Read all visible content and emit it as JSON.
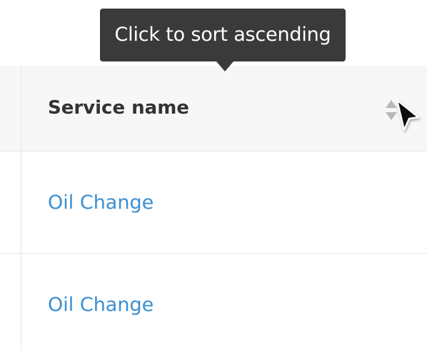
{
  "tooltip": {
    "text": "Click to sort ascending"
  },
  "table": {
    "columns": [
      {
        "label": "Service name",
        "sortable": true
      }
    ],
    "rows": [
      {
        "service_name": "Oil Change"
      },
      {
        "service_name": "Oil Change"
      }
    ]
  },
  "colors": {
    "link": "#3b8fd0",
    "tooltip_bg": "#3a3a3a",
    "header_bg": "#f7f7f7",
    "border": "#e6e6e6"
  },
  "icons": {
    "sort": "sort-toggle-icon",
    "cursor": "mouse-pointer-icon"
  }
}
